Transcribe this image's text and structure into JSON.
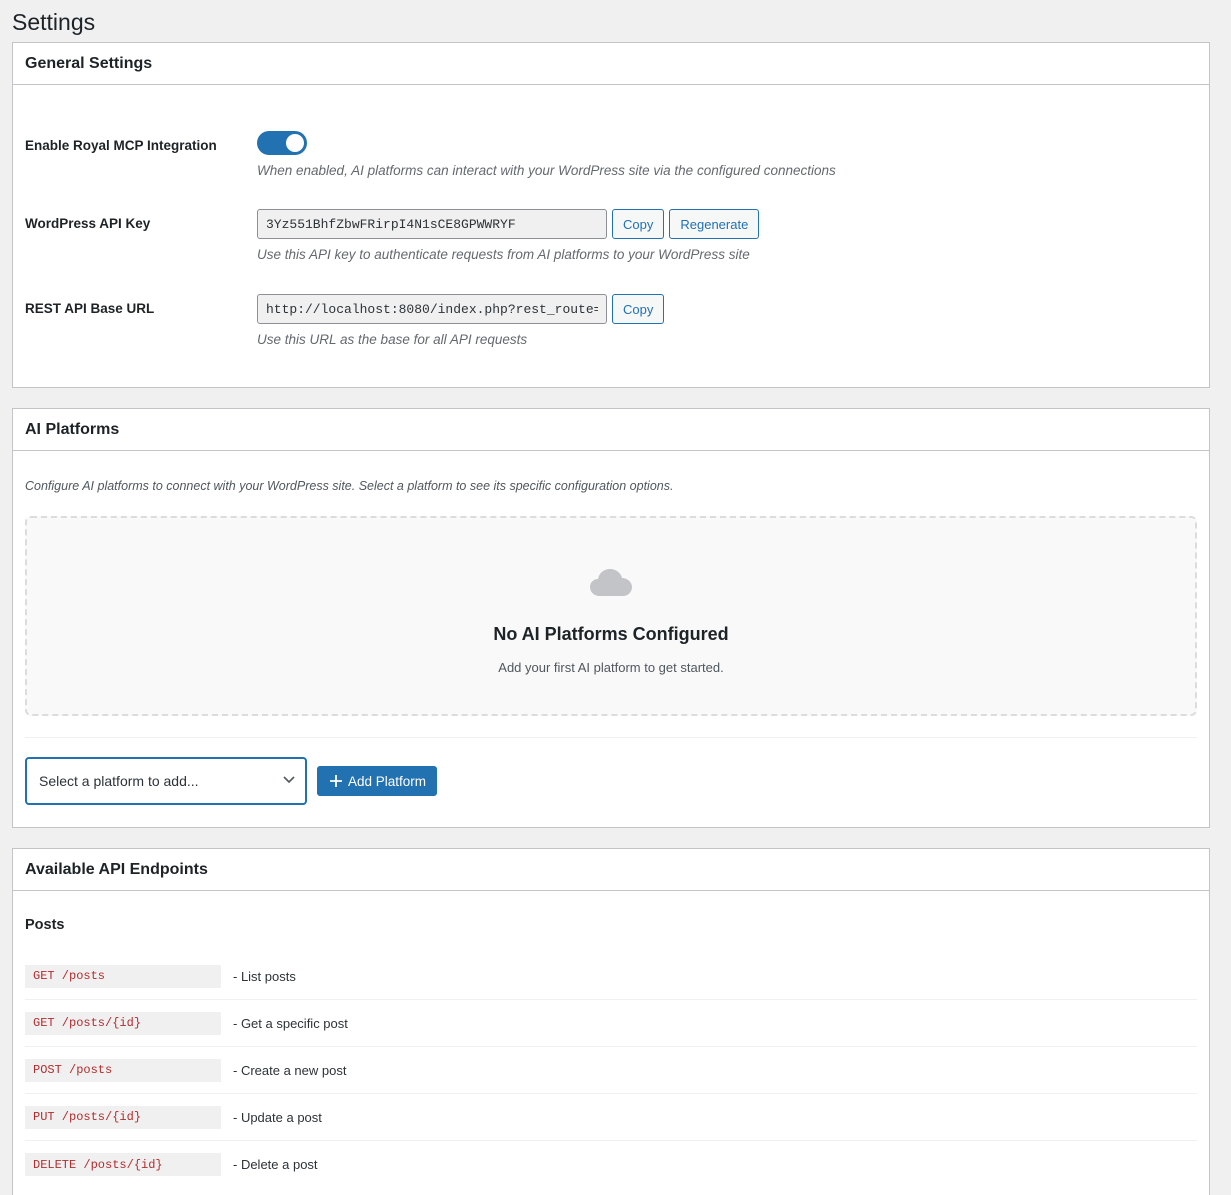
{
  "page": {
    "title": "Settings"
  },
  "general": {
    "heading": "General Settings",
    "enable": {
      "label": "Enable Royal MCP Integration",
      "enabled": true,
      "description": "When enabled, AI platforms can interact with your WordPress site via the configured connections"
    },
    "api_key": {
      "label": "WordPress API Key",
      "value": "3Yz551BhfZbwFRirpI4N1sCE8GPWWRYF",
      "copy_label": "Copy",
      "regenerate_label": "Regenerate",
      "description": "Use this API key to authenticate requests from AI platforms to your WordPress site"
    },
    "base_url": {
      "label": "REST API Base URL",
      "value": "http://localhost:8080/index.php?rest_route=",
      "copy_label": "Copy",
      "description": "Use this URL as the base for all API requests"
    }
  },
  "platforms": {
    "heading": "AI Platforms",
    "intro": "Configure AI platforms to connect with your WordPress site. Select a platform to see its specific configuration options.",
    "empty_icon": "cloud-icon",
    "empty_title": "No AI Platforms Configured",
    "empty_subtitle": "Add your first AI platform to get started.",
    "select_placeholder": "Select a platform to add...",
    "add_label": "Add Platform"
  },
  "endpoints": {
    "heading": "Available API Endpoints",
    "group_title": "Posts",
    "items": [
      {
        "method": "GET /posts",
        "description": "- List posts"
      },
      {
        "method": "GET /posts/{id}",
        "description": "- Get a specific post"
      },
      {
        "method": "POST /posts",
        "description": "- Create a new post"
      },
      {
        "method": "PUT /posts/{id}",
        "description": "- Update a post"
      },
      {
        "method": "DELETE /posts/{id}",
        "description": "- Delete a post"
      }
    ]
  },
  "colors": {
    "accent": "#2271b1",
    "code_text": "#b32d2e",
    "background": "#f0f0f1"
  }
}
